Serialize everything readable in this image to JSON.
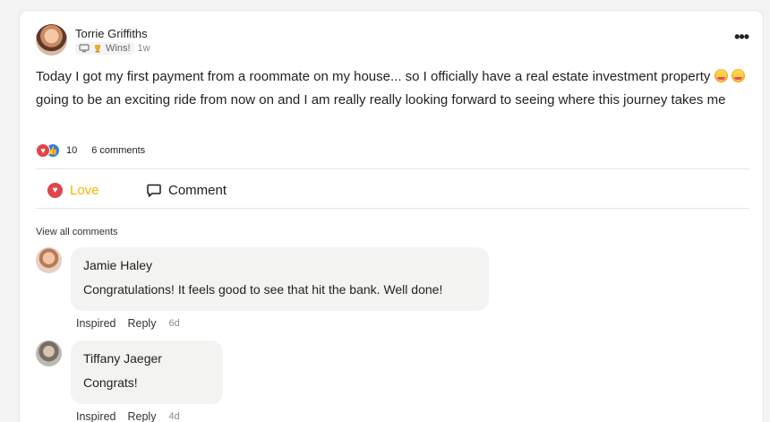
{
  "post": {
    "author": "Torrie Griffiths",
    "category": "Wins!",
    "time": "1w",
    "text": "Today I got my first payment from a roommate on my house... so I officially have a real estate investment property",
    "text_cont": "going to be an exciting ride from now on and I am really really looking forward to seeing where this journey takes me",
    "reaction_count": "10",
    "comments_label": "6 comments",
    "more_label": "•••"
  },
  "actions": {
    "love_label": "Love",
    "comment_label": "Comment",
    "love_color": "#f4b400"
  },
  "view_all_label": "View all comments",
  "comments": [
    {
      "author": "Jamie Haley",
      "text": "Congratulations! It feels good to see that hit the bank. Well done!",
      "inspired": "Inspired",
      "reply": "Reply",
      "time": "6d"
    },
    {
      "author": "Tiffany Jaeger",
      "text": "Congrats!",
      "inspired": "Inspired",
      "reply": "Reply",
      "time": "4d"
    }
  ],
  "icons": [
    "avatar",
    "monitor-icon",
    "trophy-icon",
    "more-icon",
    "star-struck-emoji",
    "heart-reaction-icon",
    "like-reaction-icon",
    "love-icon",
    "comment-icon"
  ]
}
